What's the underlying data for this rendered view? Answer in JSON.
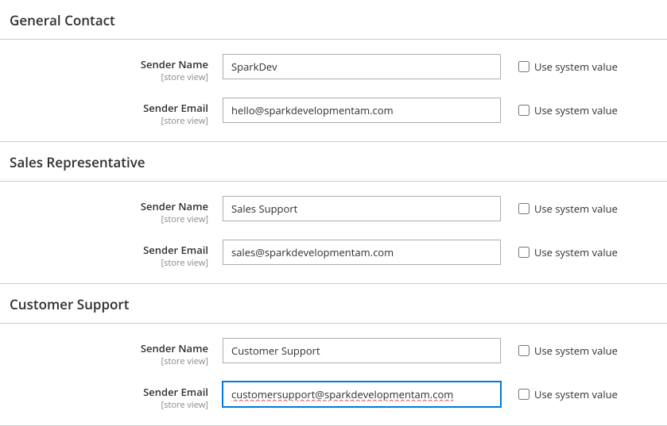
{
  "scope_label": "[store view]",
  "usv_label": "Use system value",
  "sections": {
    "general": {
      "title": "General Contact",
      "name_label": "Sender Name",
      "name_value": "SparkDev",
      "email_label": "Sender Email",
      "email_value": "hello@sparkdevelopmentam.com"
    },
    "sales": {
      "title": "Sales Representative",
      "name_label": "Sender Name",
      "name_value": "Sales Support",
      "email_label": "Sender Email",
      "email_value": "sales@sparkdevelopmentam.com"
    },
    "support": {
      "title": "Customer Support",
      "name_label": "Sender Name",
      "name_value": "Customer Support",
      "email_label": "Sender Email",
      "email_value": "customersupport@sparkdevelopmentam.com"
    }
  }
}
